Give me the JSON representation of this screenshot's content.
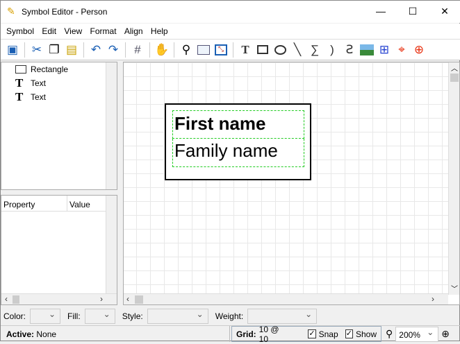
{
  "window": {
    "title": "Symbol Editor - Person",
    "minimize": "—",
    "maximize": "☐",
    "close": "✕"
  },
  "menu": [
    {
      "label": "Symbol"
    },
    {
      "label": "Edit"
    },
    {
      "label": "View"
    },
    {
      "label": "Format"
    },
    {
      "label": "Align"
    },
    {
      "label": "Help"
    }
  ],
  "tree": [
    {
      "label": "Rectangle",
      "icon": "rectangle-icon"
    },
    {
      "label": "Text",
      "icon": "text-icon"
    },
    {
      "label": "Text",
      "icon": "text-icon"
    }
  ],
  "properties": {
    "col1": "Property",
    "col2": "Value"
  },
  "canvas": {
    "first_name": "First name",
    "family_name": "Family name"
  },
  "format": {
    "color": "Color:",
    "fill": "Fill:",
    "style": "Style:",
    "weight": "Weight:"
  },
  "status": {
    "active_label": "Active:",
    "active_value": "None",
    "grid_label": "Grid:",
    "grid_value": "10 @ 10",
    "snap": "Snap",
    "show": "Show",
    "zoom": "200%",
    "snap_checked": true,
    "show_checked": true
  }
}
